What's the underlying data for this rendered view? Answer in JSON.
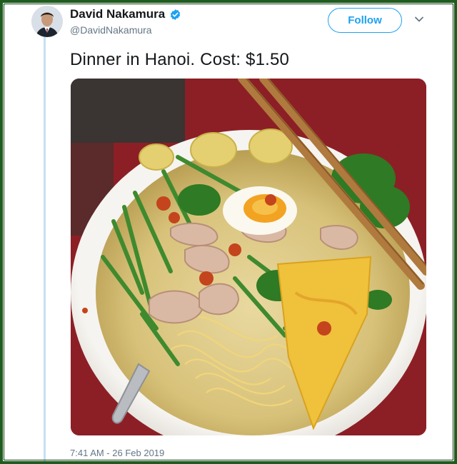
{
  "tweet": {
    "author": {
      "display_name": "David Nakamura",
      "handle": "@DavidNakamura",
      "verified": true
    },
    "follow_label": "Follow",
    "text": "Dinner in Hanoi. Cost: $1.50",
    "timestamp": "7:41 AM - 26 Feb 2019",
    "media": {
      "kind": "photo",
      "subject": "noodle soup with wontons, egg, greens and chopsticks"
    }
  },
  "icons": {
    "verified": "verified-badge-icon",
    "more": "chevron-down-icon"
  },
  "colors": {
    "accent": "#1da1f2",
    "text_primary": "#14171a",
    "text_secondary": "#657786",
    "frame": "#1f5c1f",
    "thread_line": "#c6e0f2"
  }
}
